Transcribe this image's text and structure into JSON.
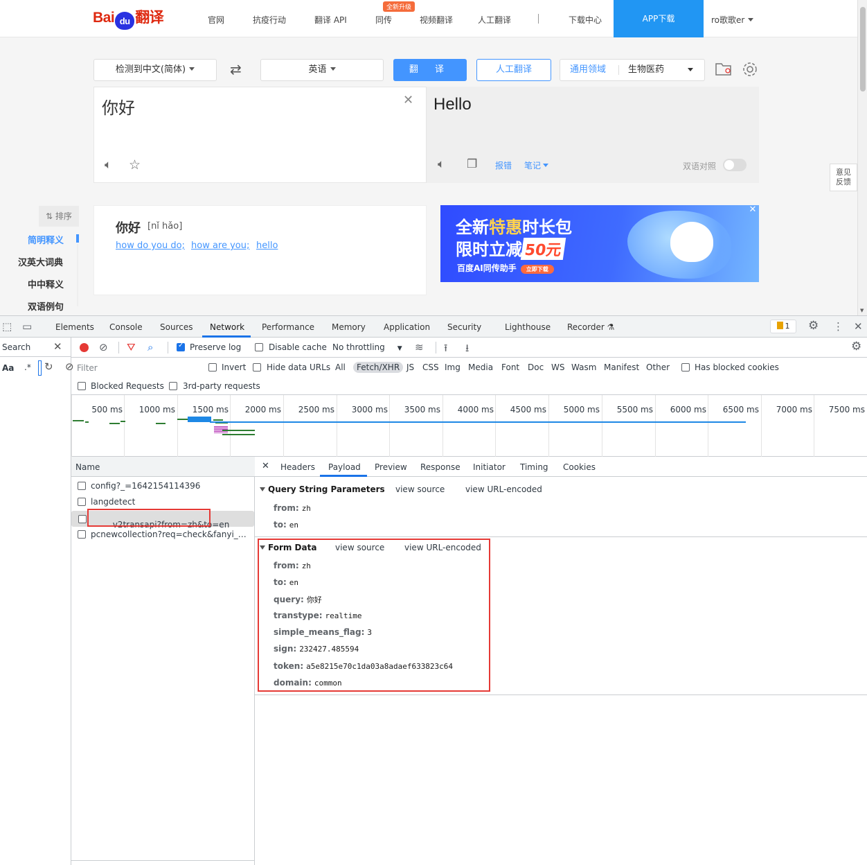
{
  "site": {
    "logo_text_a": "Bai",
    "logo_text_b": "du",
    "logo_text_c": "翻译",
    "nav": [
      "官网",
      "抗疫行动",
      "翻译 API",
      "同传",
      "视频翻译",
      "人工翻译",
      "下载中心"
    ],
    "nav_badge": "全新升级",
    "app_download": "APP下载",
    "user": "ro歌歌er"
  },
  "translator": {
    "source_lang": "检测到中文(简体)",
    "target_lang": "英语",
    "translate_btn": "翻 译",
    "human_btn": "人工翻译",
    "domain_general": "通用领域",
    "domain_selected": "生物医药",
    "input_text": "你好",
    "output_text": "Hello",
    "report_link": "报错",
    "notes_link": "笔记",
    "bilingual_label": "双语对照",
    "feedback_l1": "意见",
    "feedback_l2": "反馈"
  },
  "dictionary": {
    "sort_label": "排序",
    "side_items": [
      "简明释义",
      "汉英大词典",
      "中中释义",
      "双语例句"
    ],
    "word": "你好",
    "pinyin": "[nǐ hǎo]",
    "meanings": [
      "how do you do;",
      "how are you;",
      "hello"
    ]
  },
  "ad": {
    "line1a": "全新",
    "line1b": "特惠",
    "line1c": "时长包",
    "line2a": "限时立减",
    "line2b": "50元",
    "line3": "百度AI同传助手",
    "line3_btn": "立即下载"
  },
  "devtools": {
    "tabs": [
      "Elements",
      "Console",
      "Sources",
      "Network",
      "Performance",
      "Memory",
      "Application",
      "Security",
      "Lighthouse",
      "Recorder"
    ],
    "active_tab": "Network",
    "issues_count": "1",
    "search_label": "Search",
    "search_aa": "Aa",
    "search_regex": ".*",
    "toolbar": {
      "preserve_log": "Preserve log",
      "disable_cache": "Disable cache",
      "throttling": "No throttling"
    },
    "filter": {
      "placeholder": "Filter",
      "invert": "Invert",
      "hide_data_urls": "Hide data URLs",
      "types": [
        "All",
        "Fetch/XHR",
        "JS",
        "CSS",
        "Img",
        "Media",
        "Font",
        "Doc",
        "WS",
        "Wasm",
        "Manifest",
        "Other"
      ],
      "active_type": "Fetch/XHR",
      "has_blocked_cookies": "Has blocked cookies",
      "blocked_requests": "Blocked Requests",
      "third_party": "3rd-party requests"
    },
    "timeline_ticks": [
      "500 ms",
      "1000 ms",
      "1500 ms",
      "2000 ms",
      "2500 ms",
      "3000 ms",
      "3500 ms",
      "4000 ms",
      "4500 ms",
      "5000 ms",
      "5500 ms",
      "6000 ms",
      "6500 ms",
      "7000 ms",
      "7500 ms"
    ],
    "name_header": "Name",
    "requests": [
      "config?_=1642154114396",
      "langdetect",
      "v2transapi?from=zh&to=en",
      "pcnewcollection?req=check&fanyi_sr..."
    ],
    "selected_request": 2,
    "detail_tabs": [
      "Headers",
      "Payload",
      "Preview",
      "Response",
      "Initiator",
      "Timing",
      "Cookies"
    ],
    "active_detail_tab": "Payload",
    "query_section": {
      "title": "Query String Parameters",
      "view_source": "view source",
      "view_url_encoded": "view URL-encoded",
      "params": [
        {
          "key": "from:",
          "value": "zh"
        },
        {
          "key": "to:",
          "value": "en"
        }
      ]
    },
    "form_section": {
      "title": "Form Data",
      "view_source": "view source",
      "view_url_encoded": "view URL-encoded",
      "params": [
        {
          "key": "from:",
          "value": "zh"
        },
        {
          "key": "to:",
          "value": "en"
        },
        {
          "key": "query:",
          "value": "你好"
        },
        {
          "key": "transtype:",
          "value": "realtime"
        },
        {
          "key": "simple_means_flag:",
          "value": "3"
        },
        {
          "key": "sign:",
          "value": "232427.485594"
        },
        {
          "key": "token:",
          "value": "a5e8215e70c1da03a8adaef633823c64"
        },
        {
          "key": "domain:",
          "value": "common"
        }
      ]
    }
  }
}
